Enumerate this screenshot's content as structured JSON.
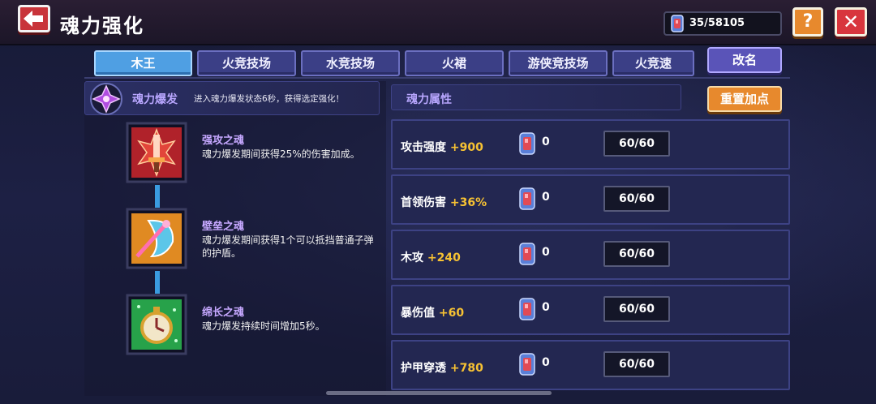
{
  "header": {
    "title": "魂力强化",
    "back_icon": "back-arrow-icon",
    "currency": {
      "icon": "soul-gem-icon",
      "value": "35/58105"
    },
    "help_label": "?",
    "close_label": "✕"
  },
  "tabs": [
    {
      "label": "木王",
      "active": true
    },
    {
      "label": "火竞技场",
      "active": false
    },
    {
      "label": "水竞技场",
      "active": false
    },
    {
      "label": "火裙",
      "active": false
    },
    {
      "label": "游侠竞技场",
      "active": false
    },
    {
      "label": "火竞速",
      "active": false
    }
  ],
  "rename_label": "改名",
  "burst": {
    "title": "魂力爆发",
    "description": "进入魂力爆发状态6秒，获得选定强化！"
  },
  "skills": [
    {
      "name": "强攻之魂",
      "description": "魂力爆发期间获得25%的伤害加成。",
      "icon": "sword-soul-icon"
    },
    {
      "name": "壁垒之魂",
      "description": "魂力爆发期间获得1个可以抵挡普通子弹的护盾。",
      "icon": "shield-soul-icon"
    },
    {
      "name": "绵长之魂",
      "description": "魂力爆发持续时间增加5秒。",
      "icon": "clock-soul-icon"
    }
  ],
  "attributes": {
    "title": "魂力属性",
    "reset_label": "重置加点",
    "rows": [
      {
        "name": "攻击强度",
        "bonus": "+900",
        "count": "0",
        "level": "60/60"
      },
      {
        "name": "首领伤害",
        "bonus": "+36%",
        "count": "0",
        "level": "60/60"
      },
      {
        "name": "木攻",
        "bonus": "+240",
        "count": "0",
        "level": "60/60"
      },
      {
        "name": "暴伤值",
        "bonus": "+60",
        "count": "0",
        "level": "60/60"
      },
      {
        "name": "护甲穿透",
        "bonus": "+780",
        "count": "0",
        "level": "60/60"
      }
    ]
  },
  "colors": {
    "accent_purple": "#b9a7ff",
    "bonus_gold": "#f7c233",
    "tab_active": "#4f9fe3",
    "button_orange": "#e7892d",
    "button_red": "#d8353d"
  }
}
